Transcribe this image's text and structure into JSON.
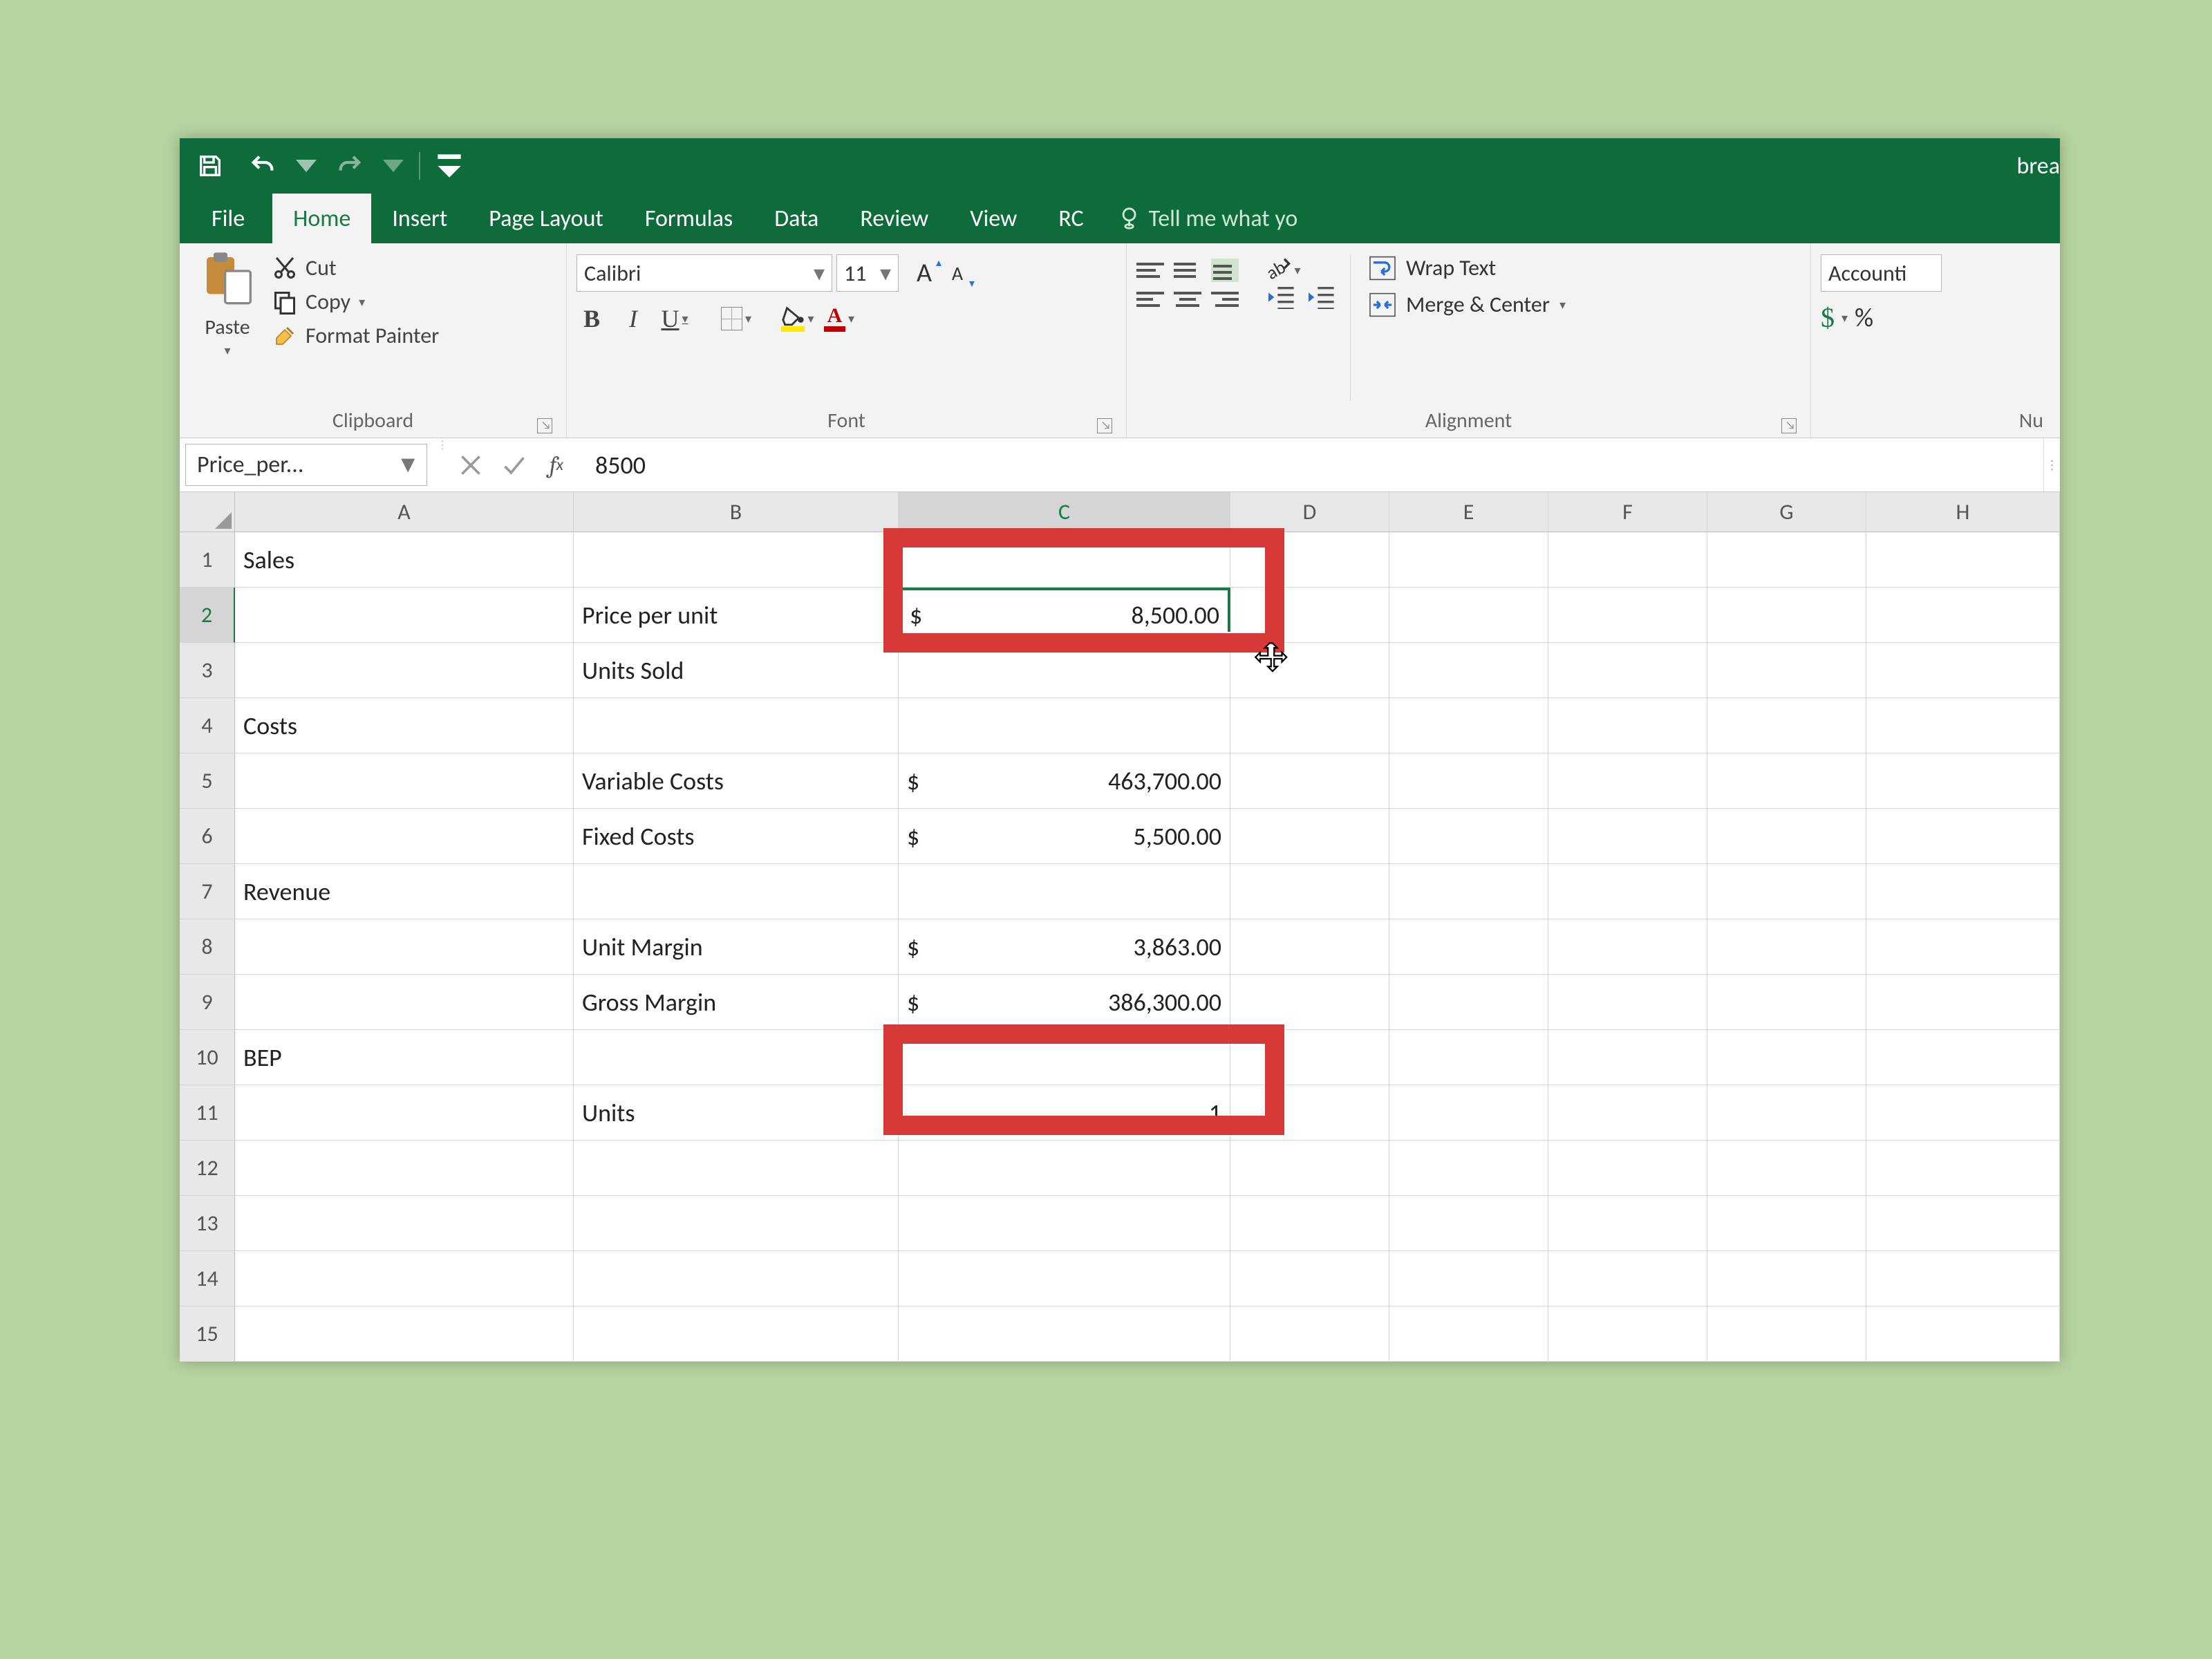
{
  "doc_title": "brea",
  "tabs": {
    "file": "File",
    "home": "Home",
    "insert": "Insert",
    "page_layout": "Page Layout",
    "formulas": "Formulas",
    "data": "Data",
    "review": "Review",
    "view": "View",
    "rc": "RC",
    "tell_me": "Tell me what yo"
  },
  "clipboard": {
    "paste": "Paste",
    "cut": "Cut",
    "copy": "Copy",
    "format_painter": "Format Painter",
    "group_label": "Clipboard"
  },
  "font": {
    "name": "Calibri",
    "size": "11",
    "group_label": "Font",
    "fontcolor_letter": "A"
  },
  "alignment": {
    "wrap": "Wrap Text",
    "merge": "Merge & Center",
    "group_label": "Alignment"
  },
  "number": {
    "format": "Accounti",
    "group_label": "Nu",
    "dollar": "$",
    "percent": "%"
  },
  "namebox": "Price_per...",
  "formula_value": "8500",
  "columns": [
    "A",
    "B",
    "C",
    "D",
    "E",
    "F",
    "G",
    "H"
  ],
  "rows": [
    {
      "n": "1",
      "A": "Sales"
    },
    {
      "n": "2",
      "B": "Price per unit",
      "C_sym": "$",
      "C_val": "8,500.00"
    },
    {
      "n": "3",
      "B": "Units Sold"
    },
    {
      "n": "4",
      "A": "Costs"
    },
    {
      "n": "5",
      "B": "Variable Costs",
      "C_sym": "$",
      "C_val": "463,700.00"
    },
    {
      "n": "6",
      "B": "Fixed Costs",
      "C_sym": "$",
      "C_val": "5,500.00"
    },
    {
      "n": "7",
      "A": "Revenue"
    },
    {
      "n": "8",
      "B": "Unit Margin",
      "C_sym": "$",
      "C_val": "3,863.00"
    },
    {
      "n": "9",
      "B": "Gross Margin",
      "C_sym": "$",
      "C_val": "386,300.00"
    },
    {
      "n": "10",
      "A": "BEP"
    },
    {
      "n": "11",
      "B": "Units",
      "C_right": "1"
    },
    {
      "n": "12"
    },
    {
      "n": "13"
    },
    {
      "n": "14"
    },
    {
      "n": "15"
    }
  ]
}
